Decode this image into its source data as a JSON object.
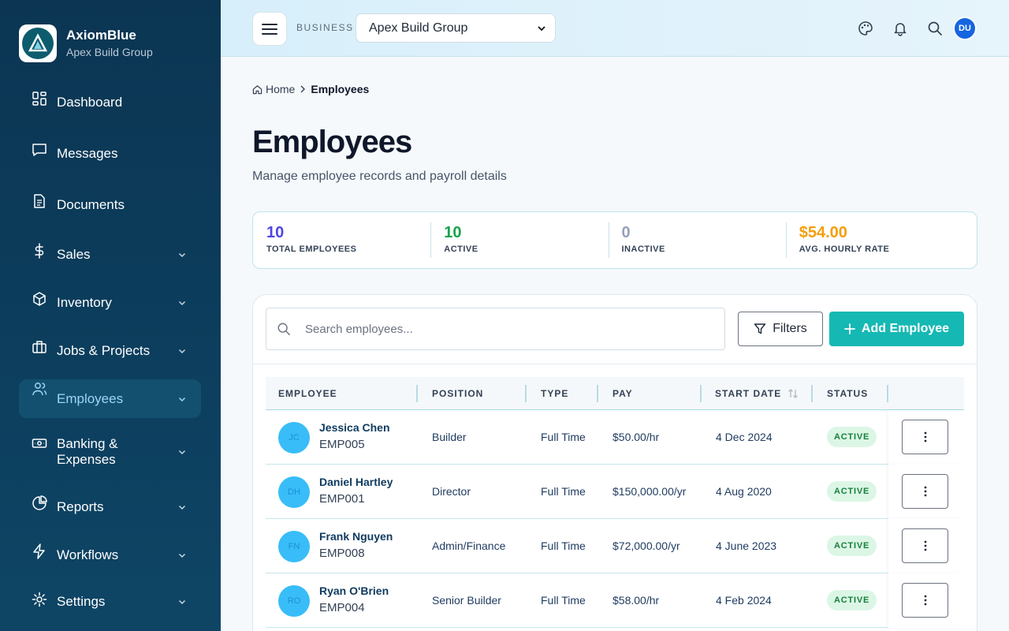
{
  "brand": {
    "name": "AxiomBlue",
    "subtitle": "Apex Build Group"
  },
  "sidebar": {
    "items": [
      {
        "label": "Dashboard",
        "icon": "dashboard-icon",
        "expandable": false,
        "active": false
      },
      {
        "label": "Messages",
        "icon": "message-icon",
        "expandable": false,
        "active": false
      },
      {
        "label": "Documents",
        "icon": "document-icon",
        "expandable": false,
        "active": false
      },
      {
        "label": "Sales",
        "icon": "dollar-icon",
        "expandable": true,
        "active": false
      },
      {
        "label": "Inventory",
        "icon": "box-icon",
        "expandable": true,
        "active": false
      },
      {
        "label": "Jobs & Projects",
        "icon": "briefcase-icon",
        "expandable": true,
        "active": false
      },
      {
        "label": "Employees",
        "icon": "users-icon",
        "expandable": true,
        "active": true
      },
      {
        "label": "Banking & Expenses",
        "icon": "banknote-icon",
        "expandable": true,
        "active": false
      },
      {
        "label": "Reports",
        "icon": "pie-chart-icon",
        "expandable": true,
        "active": false
      },
      {
        "label": "Workflows",
        "icon": "lightning-icon",
        "expandable": true,
        "active": false
      },
      {
        "label": "Settings",
        "icon": "gear-icon",
        "expandable": true,
        "active": false
      }
    ]
  },
  "header": {
    "business_label": "BUSINESS",
    "business_selected": "Apex Build Group",
    "user_initials": "DU",
    "icons": [
      "palette-icon",
      "bell-icon",
      "search-icon"
    ]
  },
  "breadcrumb": {
    "home": "Home",
    "current": "Employees"
  },
  "page": {
    "title": "Employees",
    "subtitle": "Manage employee records and payroll details"
  },
  "stats": [
    {
      "value": "10",
      "label": "TOTAL EMPLOYEES",
      "color": "#4f46e5"
    },
    {
      "value": "10",
      "label": "ACTIVE",
      "color": "#16a34a"
    },
    {
      "value": "0",
      "label": "INACTIVE",
      "color": "#94a3b8"
    },
    {
      "value": "$54.00",
      "label": "AVG. HOURLY RATE",
      "color": "#f59e0b"
    }
  ],
  "toolbar": {
    "search_placeholder": "Search employees...",
    "filters_label": "Filters",
    "add_label": "Add Employee"
  },
  "table": {
    "columns": [
      "EMPLOYEE",
      "POSITION",
      "TYPE",
      "PAY",
      "START DATE",
      "STATUS"
    ],
    "rows": [
      {
        "initials": "JC",
        "name": "Jessica Chen",
        "id": "EMP005",
        "position": "Builder",
        "type": "Full Time",
        "pay": "$50.00/hr",
        "start": "4 Dec 2024",
        "status": "ACTIVE"
      },
      {
        "initials": "DH",
        "name": "Daniel Hartley",
        "id": "EMP001",
        "position": "Director",
        "type": "Full Time",
        "pay": "$150,000.00/yr",
        "start": "4 Aug 2020",
        "status": "ACTIVE"
      },
      {
        "initials": "FN",
        "name": "Frank Nguyen",
        "id": "EMP008",
        "position": "Admin/Finance",
        "type": "Full Time",
        "pay": "$72,000.00/yr",
        "start": "4 June 2023",
        "status": "ACTIVE"
      },
      {
        "initials": "RO",
        "name": "Ryan O'Brien",
        "id": "EMP004",
        "position": "Senior Builder",
        "type": "Full Time",
        "pay": "$58.00/hr",
        "start": "4 Feb 2024",
        "status": "ACTIVE"
      }
    ]
  }
}
